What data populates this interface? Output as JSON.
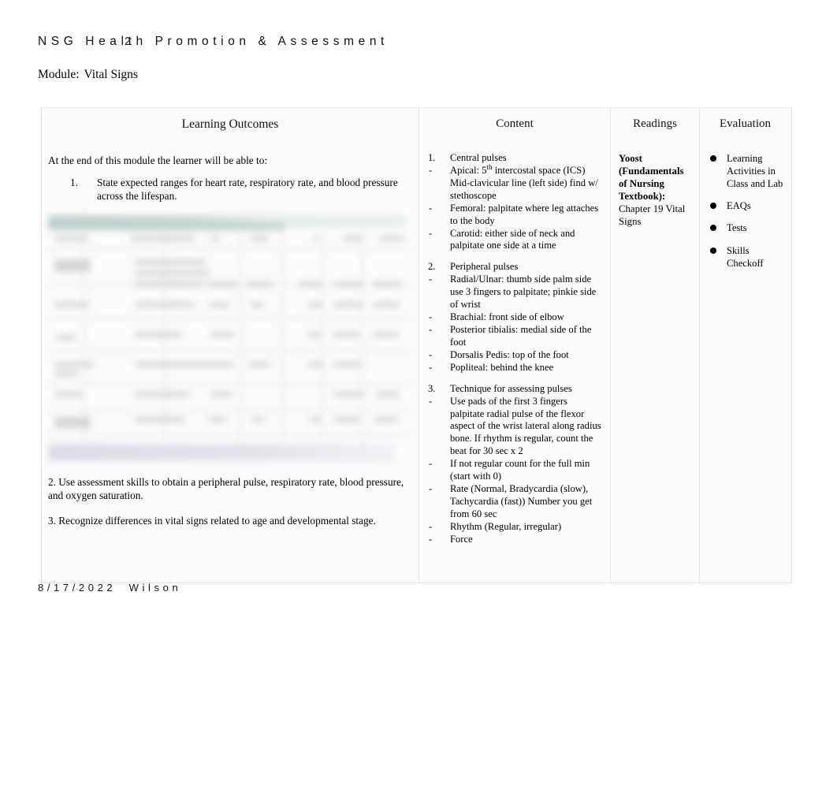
{
  "header": {
    "course_title": "NSG  Health  Promotion  &  Assessment",
    "course_number_overlay": "2",
    "module_label": "Module:",
    "module_value": "Vital Signs"
  },
  "table": {
    "columns": [
      {
        "key": "outcomes",
        "header": "Learning Outcomes"
      },
      {
        "key": "content",
        "header": "Content"
      },
      {
        "key": "readings",
        "header": "Readings"
      },
      {
        "key": "evaluation",
        "header": "Evaluation"
      }
    ],
    "outcomes": {
      "intro": "At the end of this module the learner will be able to:",
      "numbered": [
        {
          "num": "1.",
          "text": "State expected ranges for heart rate, respiratory rate, and blood pressure across the lifespan."
        }
      ],
      "figure_alt": "blurred embedded vital signs reference table image",
      "after_items": [
        "2. Use assessment skills to obtain a peripheral pulse, respiratory rate, blood pressure, and oxygen saturation.",
        "3. Recognize differences in vital signs related to age and developmental stage."
      ]
    },
    "content": {
      "groups": [
        {
          "heading_mark": "1.",
          "heading": "Central pulses",
          "items": [
            {
              "mark": "-",
              "text_before": "Apical: 5",
              "sup": "th",
              "text_after": " intercostal space (ICS) Mid-clavicular line (left side) find w/ stethoscope"
            },
            {
              "mark": "-",
              "text": "Femoral: palpitate where leg attaches to the body"
            },
            {
              "mark": "-",
              "text": "Carotid: either side of neck and palpitate one side at a time"
            }
          ]
        },
        {
          "heading_mark": "2.",
          "heading": "Peripheral pulses",
          "items": [
            {
              "mark": "-",
              "text": "Radial/Ulnar: thumb side palm side use 3 fingers to palpitate; pinkie side of wrist"
            },
            {
              "mark": "-",
              "text": "Brachial: front side of elbow"
            },
            {
              "mark": "-",
              "text": "Posterior tibialis: medial side of the foot"
            },
            {
              "mark": "-",
              "text": "Dorsalis Pedis: top of the foot"
            },
            {
              "mark": "-",
              "text": "Popliteal: behind the knee"
            }
          ]
        },
        {
          "heading_mark": "3.",
          "heading": "Technique for assessing pulses",
          "items": [
            {
              "mark": "-",
              "text": "Use pads of the first 3 fingers palpitate radial pulse of the flexor aspect of the wrist lateral along radius bone. If rhythm is regular, count the beat for 30 sec x 2"
            },
            {
              "mark": "-",
              "text": "If not regular count for the full min (start with 0)"
            },
            {
              "mark": "-",
              "text": "Rate (Normal, Bradycardia (slow), Tachycardia (fast)) Number you get from 60 sec"
            },
            {
              "mark": "-",
              "text": "Rhythm (Regular, irregular)"
            },
            {
              "mark": "-",
              "text": "Force"
            }
          ]
        }
      ]
    },
    "readings": {
      "bold_text": "Yoost (Fundamentals of Nursing Textbook):",
      "plain_text": " Chapter 19 Vital Signs"
    },
    "evaluation": {
      "items": [
        "Learning Activities in Class and Lab",
        "EAQs",
        "Tests",
        "Skills Checkoff"
      ]
    }
  },
  "footer": {
    "date": "8/17/2022",
    "author": "Wilson"
  },
  "colors": {
    "figure_header_teal": "#c3d6d2",
    "figure_footer_lavender": "#d7d7e6",
    "grid_line": "#e6e6e6",
    "text": "#000000"
  }
}
